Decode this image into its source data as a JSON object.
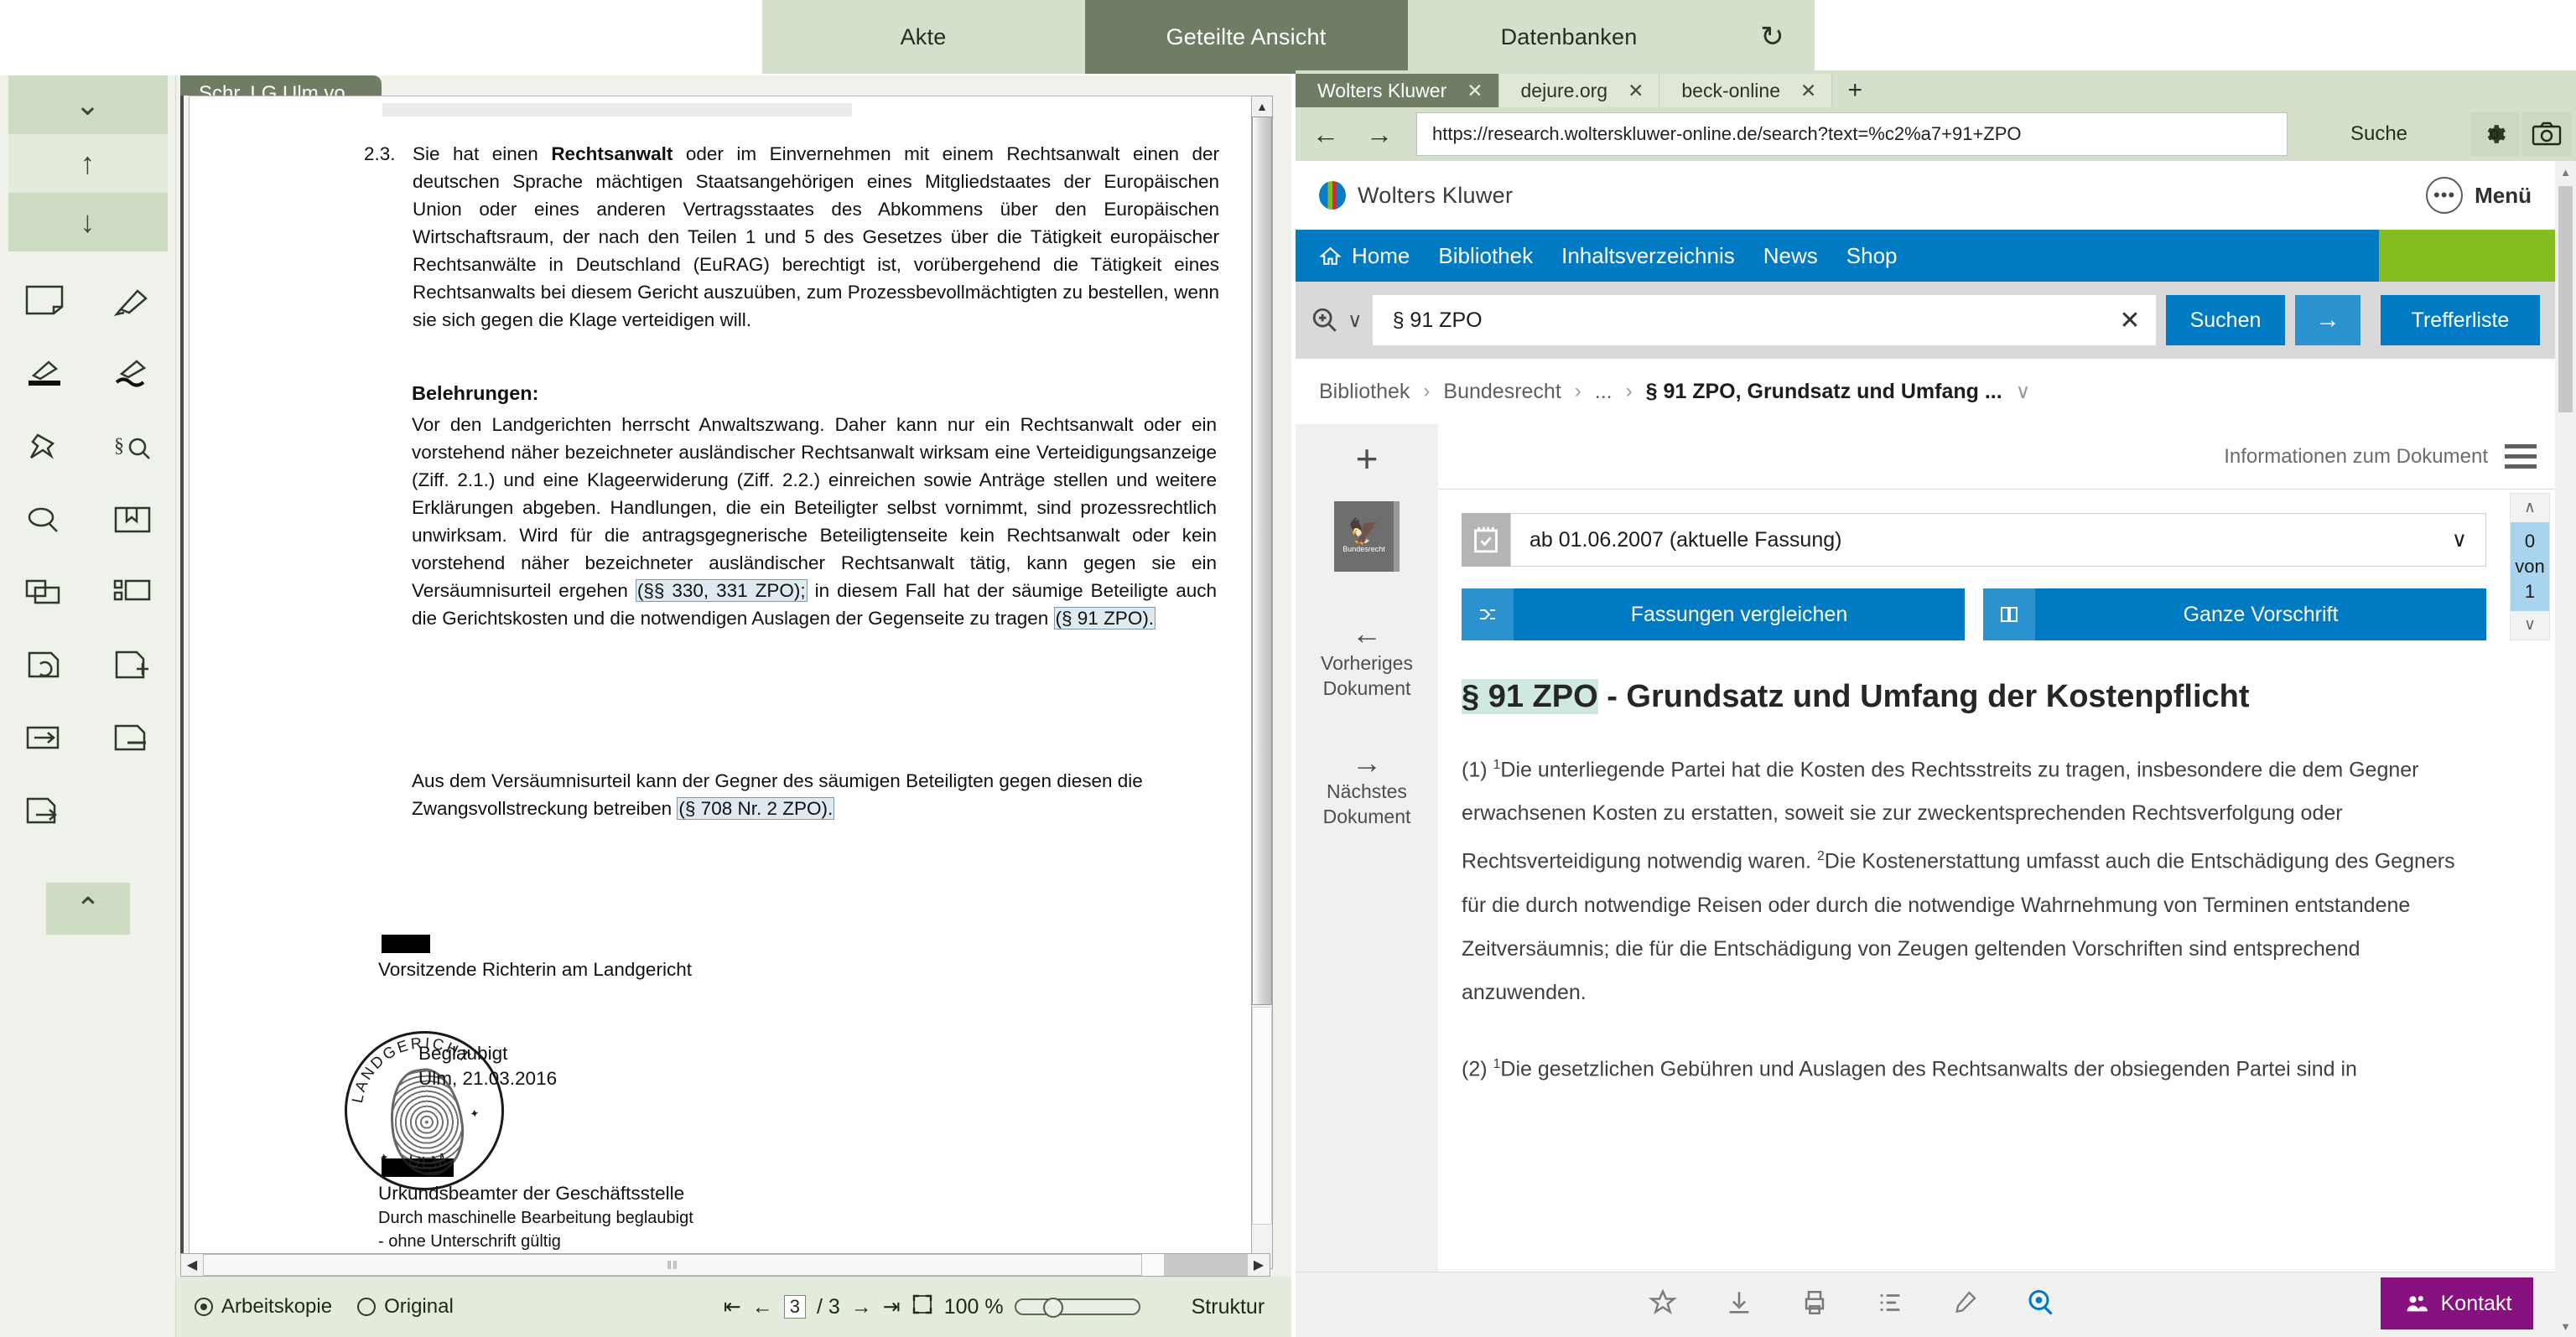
{
  "app_tabs": {
    "items": [
      {
        "label": "Akte",
        "active": false
      },
      {
        "label": "Geteilte Ansicht",
        "active": true
      },
      {
        "label": "Datenbanken",
        "active": false
      }
    ],
    "refresh_icon": "refresh-icon",
    "refresh_glyph": "↻"
  },
  "tool_rail": {
    "collapse_down_glyph": "⌄",
    "up_glyph": "↑",
    "down_glyph": "↓",
    "collapse_up_glyph": "⌃",
    "icons": [
      "note-icon",
      "highlighter-icon",
      "marker-underline-icon",
      "marker-wave-icon",
      "pin-icon",
      "paragraph-search-icon",
      "magnifier-icon",
      "bookmark-book-icon",
      "copy-pages-icon",
      "thumbnails-icon",
      "page-rotate-icon",
      "page-add-icon",
      "page-move-icon",
      "page-remove-icon",
      "page-export-icon"
    ]
  },
  "pdf": {
    "tab_label": "Schr. LG Ulm vo...",
    "clause": {
      "number": "2.3.",
      "text_parts": [
        {
          "t": "Sie hat einen ",
          "b": false
        },
        {
          "t": "Rechtsanwalt",
          "b": true
        },
        {
          "t": " oder im Einvernehmen mit einem Rechtsanwalt einen der deutschen Sprache mächtigen Staatsangehörigen eines Mitgliedstaates der Europäischen Union oder eines anderen Vertragsstaates des Abkommens über den Europäischen Wirtschaftsraum, der nach den Teilen 1 und 5 des Gesetzes über die Tätigkeit europäischer Rechtsanwälte in Deutschland (EuRAG) berechtigt ist, vorübergehend die Tätigkeit eines Rechtsanwalts bei diesem Gericht auszuüben, zum Prozessbevollmächtigten zu bestellen, wenn sie sich gegen die Klage verteidigen will.",
          "b": false
        }
      ]
    },
    "belehrungen": {
      "heading": "Belehrungen:",
      "p1_a": "Vor den Landgerichten herrscht Anwaltszwang. Daher kann nur ein Rechtsanwalt oder ein vorstehend näher bezeichneter ausländischer Rechtsanwalt wirksam eine Verteidigungsanzeige (Ziff. 2.1.) und eine Klageerwiderung (Ziff. 2.2.) einreichen sowie Anträge stellen und weitere Erklärungen abgeben. Handlungen, die ein Beteiligter selbst vornimmt, sind prozessrechtlich unwirksam. Wird für die antragsgegnerische Beteiligtenseite kein Rechtsanwalt oder kein vorstehend näher bezeichneter ausländischer Rechtsanwalt tätig, kann gegen sie ein Versäumnisurteil ergehen ",
      "cite1": "(§§ 330, 331 ZPO);",
      "p1_b": " in diesem Fall hat der säumige Beteiligte auch die Gerichtskosten und die notwendigen Auslagen der Gegenseite zu tragen ",
      "cite2": "(§ 91 ZPO).",
      "p2_a": "Aus dem Versäumnisurteil kann der Gegner des säumigen Beteiligten gegen diesen die Zwangsvollstreckung betreiben ",
      "cite3": "(§ 708 Nr. 2 ZPO)."
    },
    "signature": {
      "role1": "Vorsitzende Richterin am Landgericht",
      "stamp_text": "LANDGERICHT",
      "stamp_city": "ULM",
      "certify1": "Beglaubigt",
      "certify2": "Ulm, 21.03.2016",
      "role2": "Urkundsbeamter der Geschäftsstelle",
      "note1": "Durch maschinelle Bearbeitung beglaubigt",
      "note2": "- ohne Unterschrift gültig"
    },
    "statusbar": {
      "radio_arbeitskopie": "Arbeitskopie",
      "radio_original": "Original",
      "first_glyph": "⇤",
      "prev_glyph": "←",
      "page_current": "3",
      "page_sep": "/ 3",
      "next_glyph": "→",
      "last_glyph": "⇥",
      "fit_icon": "fit-page-icon",
      "zoom_level": "100 %",
      "struktur_label": "Struktur"
    },
    "hscroll": {
      "left_glyph": "◀",
      "right_glyph": "▶",
      "grip": "‖‖"
    }
  },
  "browser": {
    "tabs": [
      {
        "label": "Wolters Kluwer",
        "active": true,
        "close": "✕"
      },
      {
        "label": "dejure.org",
        "active": false,
        "close": "✕"
      },
      {
        "label": "beck-online",
        "active": false,
        "close": "✕"
      }
    ],
    "new_tab_glyph": "+",
    "back_glyph": "←",
    "forward_glyph": "→",
    "url": "https://research.wolterskluwer-online.de/search?text=%c2%a7+91+ZPO",
    "search_label": "Suche",
    "settings_icon": "gear-icon",
    "screenshot_icon": "camera-icon"
  },
  "wk": {
    "brand": "Wolters Kluwer",
    "menu_label": "Menü",
    "menu_dots": "•••",
    "nav": [
      {
        "label": "Home",
        "icon": "home-icon"
      },
      {
        "label": "Bibliothek",
        "icon": null
      },
      {
        "label": "Inhaltsverzeichnis",
        "icon": null
      },
      {
        "label": "News",
        "icon": null
      },
      {
        "label": "Shop",
        "icon": null
      }
    ],
    "search": {
      "icon": "magnifier-plus-icon",
      "dropdown_glyph": "∨",
      "value": "§ 91 ZPO",
      "clear_glyph": "✕",
      "submit_label": "Suchen",
      "arrow_glyph": "→",
      "trefferliste_label": "Trefferliste"
    },
    "breadcrumb": {
      "items": [
        "Bibliothek",
        "Bundesrecht",
        "...",
        "§ 91 ZPO, Grundsatz und Umfang ..."
      ],
      "sep": "›",
      "dropdown_glyph": "∨"
    },
    "sidebar": {
      "plus_glyph": "+",
      "book_label": "Bundesrecht",
      "book_icon": "bundesrecht-book-icon",
      "prev": {
        "arrow": "←",
        "line1": "Vorheriges",
        "line2": "Dokument"
      },
      "next": {
        "arrow": "→",
        "line1": "Nächstes",
        "line2": "Dokument"
      }
    },
    "doc": {
      "info_label": "Informationen zum Dokument",
      "hamburger_icon": "hamburger-icon",
      "calendar_icon": "calendar-check-icon",
      "version_value": "ab 01.06.2007 (aktuelle Fassung)",
      "version_caret": "∨",
      "btn_compare": {
        "label": "Fassungen vergleichen",
        "icon": "compare-icon"
      },
      "btn_full": {
        "label": "Ganze Vorschrift",
        "icon": "book-open-icon"
      },
      "counter": {
        "up": "∧",
        "value": "0",
        "of": "von",
        "total": "1",
        "down": "∨"
      },
      "title_highlight": "§ 91 ZPO",
      "title_rest": " - Grundsatz und Umfang der Kostenpflicht",
      "para1_pre": "(1) ",
      "para1_sup": "1",
      "para1_a": "Die unterliegende Partei hat die Kosten des Rechtsstreits zu tragen, insbesondere die dem Gegner erwachsenen Kosten zu erstatten, soweit sie zur zweckentsprechenden Rechtsverfolgung oder Rechtsverteidigung notwendig waren. ",
      "para1_sup2": "2",
      "para1_b": "Die Kostenerstattung umfasst auch die Entschädigung des Gegners für die durch notwendige Reisen oder durch die notwendige Wahrnehmung von Terminen entstandene Zeitversäumnis; die für die Entschädigung von Zeugen geltenden Vorschriften sind entsprechend anzuwenden.",
      "para2_pre": "(2) ",
      "para2_sup": "1",
      "para2_a": "Die gesetzlichen Gebühren und Auslagen des Rechtsanwalts der obsiegenden Partei sind in"
    },
    "bottombar": {
      "icons": [
        "favorite-star-icon",
        "download-icon",
        "print-icon",
        "list-icon",
        "pen-icon",
        "zoom-search-icon"
      ],
      "kontakt_label": "Kontakt",
      "kontakt_icon": "contact-people-icon",
      "kontakt_color": "#87127f"
    }
  },
  "colors": {
    "app_chrome": "#d4e0cb",
    "app_chrome_active": "#6f7d64",
    "wk_blue": "#007ac3",
    "wk_green": "#85bc20",
    "kontakt_purple": "#87127f",
    "highlight_mint": "#cfe8e0",
    "counter_blue": "#a8d4ef"
  }
}
